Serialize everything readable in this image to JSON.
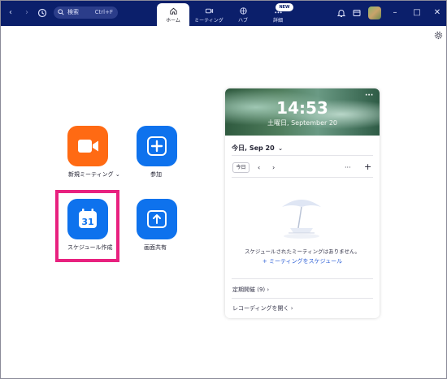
{
  "topbar": {
    "search_label": "検索",
    "search_shortcut": "Ctrl+F",
    "tabs": [
      {
        "label": "ホーム",
        "icon": "home-icon",
        "active": true
      },
      {
        "label": "ミーティング",
        "icon": "video-icon",
        "active": false
      },
      {
        "label": "ハブ",
        "icon": "hub-icon",
        "active": false
      },
      {
        "label": "詳細",
        "icon": "more-icon",
        "active": false,
        "badge": "NEW"
      }
    ],
    "colors": {
      "bar": "#0b1f6b",
      "accent": "#0e72ed",
      "orange": "#ff6a13",
      "highlight": "#e8217f"
    }
  },
  "actions": [
    {
      "label": "新規ミーティング",
      "icon": "video-camera-icon",
      "has_dropdown": true
    },
    {
      "label": "参加",
      "icon": "plus-icon"
    },
    {
      "label": "スケジュール作成",
      "icon": "calendar-icon",
      "icon_text": "31"
    },
    {
      "label": "画面共有",
      "icon": "share-up-arrow-icon"
    }
  ],
  "calendar": {
    "time": "14:53",
    "date_line": "土曜日, September 20",
    "day_selector": "今日, Sep 20",
    "today_button": "今日",
    "empty_message": "スケジュールされたミーティングはありません。",
    "schedule_link": "ミーティングをスケジュール",
    "recurring_label": "定期開催 (9)",
    "recordings_label": "レコーディングを開く"
  }
}
